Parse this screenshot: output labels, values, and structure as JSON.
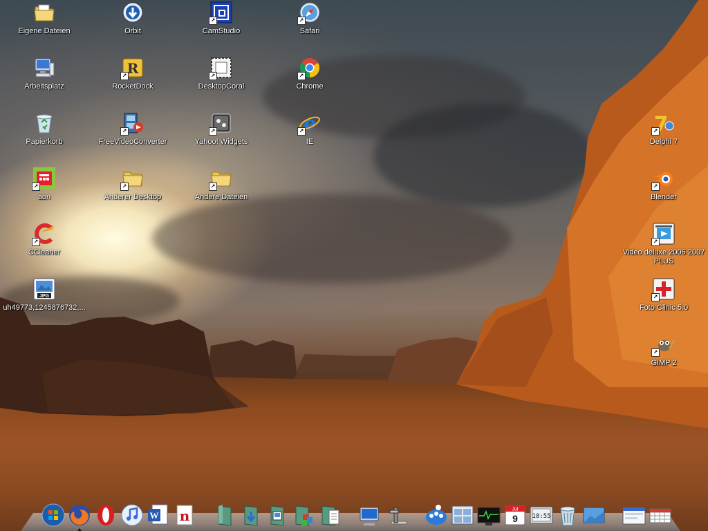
{
  "desktop": {
    "icons": [
      {
        "label": "Eigene Dateien",
        "icon": "folder-documents-icon"
      },
      {
        "label": "Arbeitsplatz",
        "icon": "computer-icon"
      },
      {
        "label": "Papierkorb",
        "icon": "recycle-bin-icon"
      },
      {
        "label": "aon",
        "icon": "aon-icon"
      },
      {
        "label": "CCleaner",
        "icon": "ccleaner-icon"
      },
      {
        "label": "uh49773,1245876732,...",
        "icon": "jpg-file-icon"
      },
      {
        "label": "Orbit",
        "icon": "orbit-icon"
      },
      {
        "label": "RocketDock",
        "icon": "rocketdock-icon"
      },
      {
        "label": "FreeVideoConverter",
        "icon": "video-converter-icon"
      },
      {
        "label": "Anderer Desktop",
        "icon": "folder-icon"
      },
      {
        "label": "CamStudio",
        "icon": "camstudio-icon"
      },
      {
        "label": "DesktopCoral",
        "icon": "desktopcoral-icon"
      },
      {
        "label": "Yahoo! Widgets",
        "icon": "yahoo-widgets-icon"
      },
      {
        "label": "Andere Dateien",
        "icon": "folder-icon"
      },
      {
        "label": "Safari",
        "icon": "safari-icon"
      },
      {
        "label": "Chrome",
        "icon": "chrome-icon"
      },
      {
        "label": "IE",
        "icon": "internet-explorer-icon"
      },
      {
        "label": "Delphi 7",
        "icon": "delphi-icon"
      },
      {
        "label": "Blender",
        "icon": "blender-icon"
      },
      {
        "label": "Video deluxe 2006 2007 PLUS",
        "icon": "video-deluxe-icon"
      },
      {
        "label": "Foto Clinic 5.0",
        "icon": "foto-clinic-icon"
      },
      {
        "label": "GIMP 2",
        "icon": "gimp-icon"
      }
    ]
  },
  "dock": {
    "items": [
      {
        "icon": "windows-start-icon"
      },
      {
        "icon": "firefox-icon"
      },
      {
        "icon": "opera-icon"
      },
      {
        "icon": "itunes-icon"
      },
      {
        "icon": "word-icon"
      },
      {
        "icon": "netscape-icon"
      },
      {
        "icon": "stack-folder-icon"
      },
      {
        "icon": "downloads-stack-icon"
      },
      {
        "icon": "pictures-stack-icon"
      },
      {
        "icon": "apps-stack-icon"
      },
      {
        "icon": "documents-stack-icon"
      },
      {
        "icon": "my-computer-icon"
      },
      {
        "icon": "control-panel-icon"
      },
      {
        "icon": "messenger-icon"
      },
      {
        "icon": "window-manager-icon"
      },
      {
        "icon": "task-monitor-icon"
      },
      {
        "icon": "calendar-icon"
      },
      {
        "icon": "clock-icon"
      },
      {
        "icon": "trash-icon"
      },
      {
        "icon": "show-desktop-icon"
      },
      {
        "icon": "browser-window-icon"
      },
      {
        "icon": "grid-view-icon"
      }
    ],
    "calendar": {
      "month": "Jul",
      "day": "9"
    },
    "clock": {
      "time": "18:55"
    }
  }
}
